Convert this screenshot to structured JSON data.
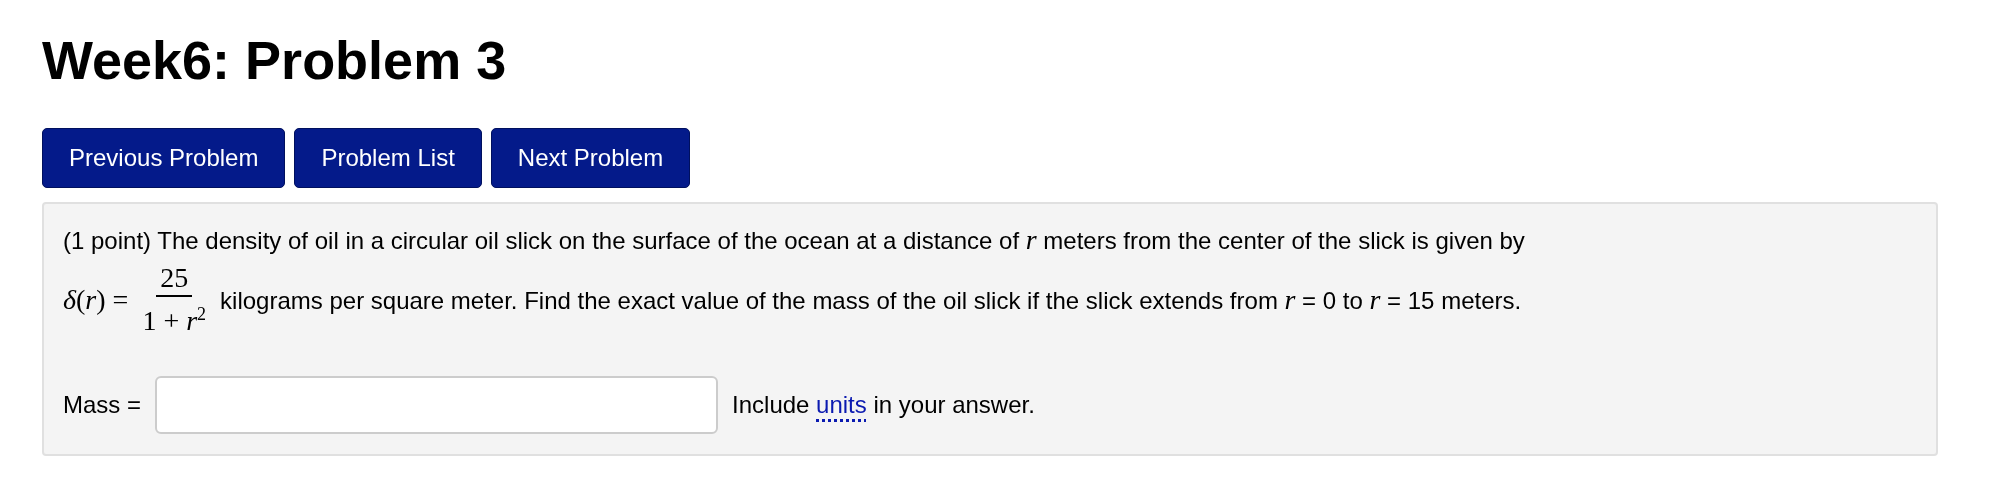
{
  "title": "Week6: Problem 3",
  "nav_buttons": [
    "Previous Problem",
    "Problem List",
    "Next Problem"
  ],
  "problem": {
    "intro": "(1 point) The density of oil in a circular oil slick on the surface of the ocean at a distance of *r* meters from the center of the slick is given by",
    "formula": {
      "lhs": "*δ*(*r*) =",
      "numerator": "25",
      "denominator": "1 + *r*$^{2}$"
    },
    "statement": "kilograms per square meter. Find the exact value of the mass of the oil slick if the slick extends from *r* = 0 to *r* = 15 meters."
  },
  "answer": {
    "label": "Mass =",
    "hint_before": "Include",
    "hint_link": "units",
    "hint_after": "in your answer."
  }
}
